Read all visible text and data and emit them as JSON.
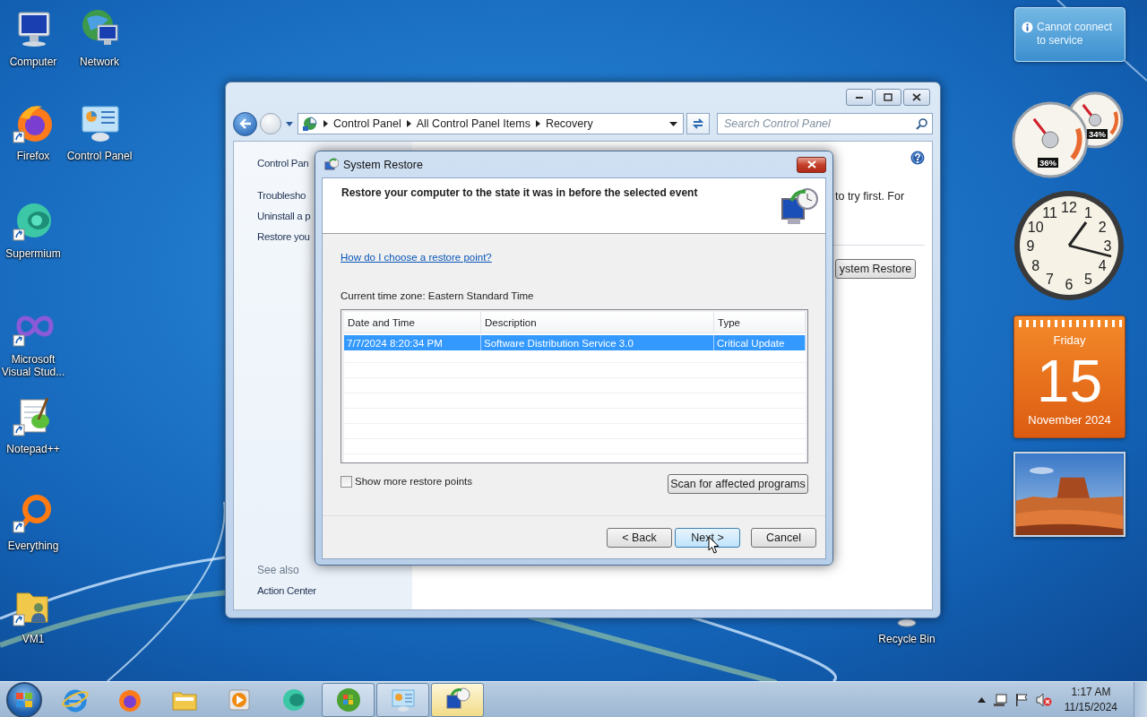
{
  "desktop_icons": [
    {
      "label": "Computer"
    },
    {
      "label": "Firefox"
    },
    {
      "label": "Supermium"
    },
    {
      "label": "Microsoft Visual Stud..."
    },
    {
      "label": "Notepad++"
    },
    {
      "label": "Everything"
    },
    {
      "label": "VM1"
    },
    {
      "label": "Network"
    },
    {
      "label": "Control Panel"
    },
    {
      "label": "Recycle Bin"
    }
  ],
  "control_panel_window": {
    "address_path": [
      "Control Panel",
      "All Control Panel Items",
      "Recovery"
    ],
    "search": {
      "placeholder": "Search Control Panel"
    },
    "sidebar": {
      "links": [
        "Control Pan",
        "Troublesho",
        "Uninstall a p",
        "Restore you"
      ],
      "see_also_heading": "See also",
      "see_also_links": [
        "Action Center"
      ]
    },
    "main": {
      "text": "to try first. For",
      "button": "ystem Restore"
    }
  },
  "system_restore_dialog": {
    "title": "System Restore",
    "heading": "Restore your computer to the state it was in before the selected event",
    "help_link": "How do I choose a restore point?",
    "time_zone": "Current time zone: Eastern Standard Time",
    "table": {
      "columns": [
        "Date and Time",
        "Description",
        "Type"
      ],
      "rows": [
        {
          "cells": [
            "7/7/2024 8:20:34 PM",
            "Software Distribution Service 3.0",
            "Critical Update"
          ],
          "selected": true
        }
      ]
    },
    "show_more": {
      "label": "Show more restore points",
      "checked": false
    },
    "scan_button": "Scan for affected programs",
    "buttons": [
      {
        "label": "< Back",
        "highlighted": false
      },
      {
        "label": "Next >",
        "highlighted": true
      },
      {
        "label": "Cancel",
        "highlighted": false
      }
    ]
  },
  "gadgets": {
    "notification": "Cannot connect to service",
    "cpu_meter": {
      "gauges": [
        {
          "reading": "36%"
        },
        {
          "reading": "34%"
        }
      ]
    },
    "clock_numerals": [
      "12",
      "11",
      "1",
      "10",
      "2",
      "9",
      "3",
      "8",
      "4",
      "7",
      "5",
      "6"
    ],
    "calendar": {
      "weekday": "Friday",
      "day": "15",
      "month_year": "November 2024"
    }
  },
  "taskbar": {
    "items": [
      {
        "running": false,
        "selected": false
      },
      {
        "running": false,
        "selected": false
      },
      {
        "running": false,
        "selected": false
      },
      {
        "running": false,
        "selected": false
      },
      {
        "running": false,
        "selected": false
      },
      {
        "running": true,
        "selected": false
      },
      {
        "running": true,
        "selected": false
      },
      {
        "running": true,
        "selected": true
      }
    ],
    "clock": {
      "time": "1:17 AM",
      "date": "11/15/2024"
    }
  }
}
